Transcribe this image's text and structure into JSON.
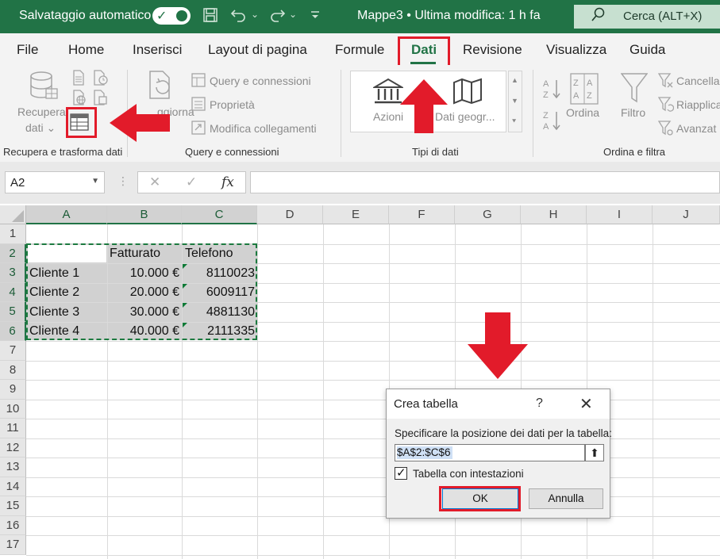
{
  "titlebar": {
    "autosave_label": "Salvataggio automatico",
    "doc_title": "Mappe3 • Ultima modifica: 1 h fa",
    "dropdown_glyph": "⌄",
    "search_label": "Cerca (ALT+X)"
  },
  "tabs": [
    "File",
    "Home",
    "Inserisci",
    "Layout di pagina",
    "Formule",
    "Dati",
    "Revisione",
    "Visualizza",
    "Guida"
  ],
  "active_tab": "Dati",
  "ribbon": {
    "get_data": {
      "label_line1": "Recupera",
      "label_line2": "dati ⌄"
    },
    "refresh_partial": "ggiorna",
    "queries": {
      "query_connections": "Query e connessioni",
      "properties": "Proprietà",
      "edit_links": "Modifica collegamenti"
    },
    "data_types": {
      "stocks": "Azioni",
      "geography": "Dati geogr..."
    },
    "sort_filter": {
      "sort": "Ordina",
      "filter": "Filtro",
      "clear": "Cancella",
      "reapply": "Riapplica",
      "advanced": "Avanzat"
    },
    "groups": {
      "get_transform": "Recupera e trasforma dati",
      "queries_connections": "Query e connessioni",
      "data_types": "Tipi di dati",
      "sort_filter": "Ordina e filtra"
    }
  },
  "formula_bar": {
    "name_box": "A2",
    "fx": "fx",
    "cancel": "✕",
    "enter": "✓",
    "value": ""
  },
  "columns": [
    "A",
    "B",
    "C",
    "D",
    "E",
    "F",
    "G",
    "H",
    "I",
    "J"
  ],
  "rows": [
    "1",
    "2",
    "3",
    "4",
    "5",
    "6",
    "7",
    "8",
    "9",
    "10",
    "11",
    "12",
    "13",
    "14",
    "15",
    "16",
    "17"
  ],
  "table": {
    "headers": [
      "",
      "Fatturato",
      "Telefono"
    ],
    "rows": [
      [
        "Cliente 1",
        "10.000 €",
        "8110023"
      ],
      [
        "Cliente 2",
        "20.000 €",
        "6009117"
      ],
      [
        "Cliente 3",
        "30.000 €",
        "4881130"
      ],
      [
        "Cliente 4",
        "40.000 €",
        "2111335"
      ]
    ]
  },
  "dialog": {
    "title": "Crea tabella",
    "help": "?",
    "close": "✕",
    "prompt": "Specificare la posizione dei dati per la tabella:",
    "range": "$A$2:$C$6",
    "collapse": "⬆",
    "headers_checkbox_label": "Tabella con intestazioni",
    "headers_checked": true,
    "ok": "OK",
    "cancel": "Annulla"
  },
  "colors": {
    "excel_green": "#217346",
    "highlight_red": "#e21b2a"
  }
}
